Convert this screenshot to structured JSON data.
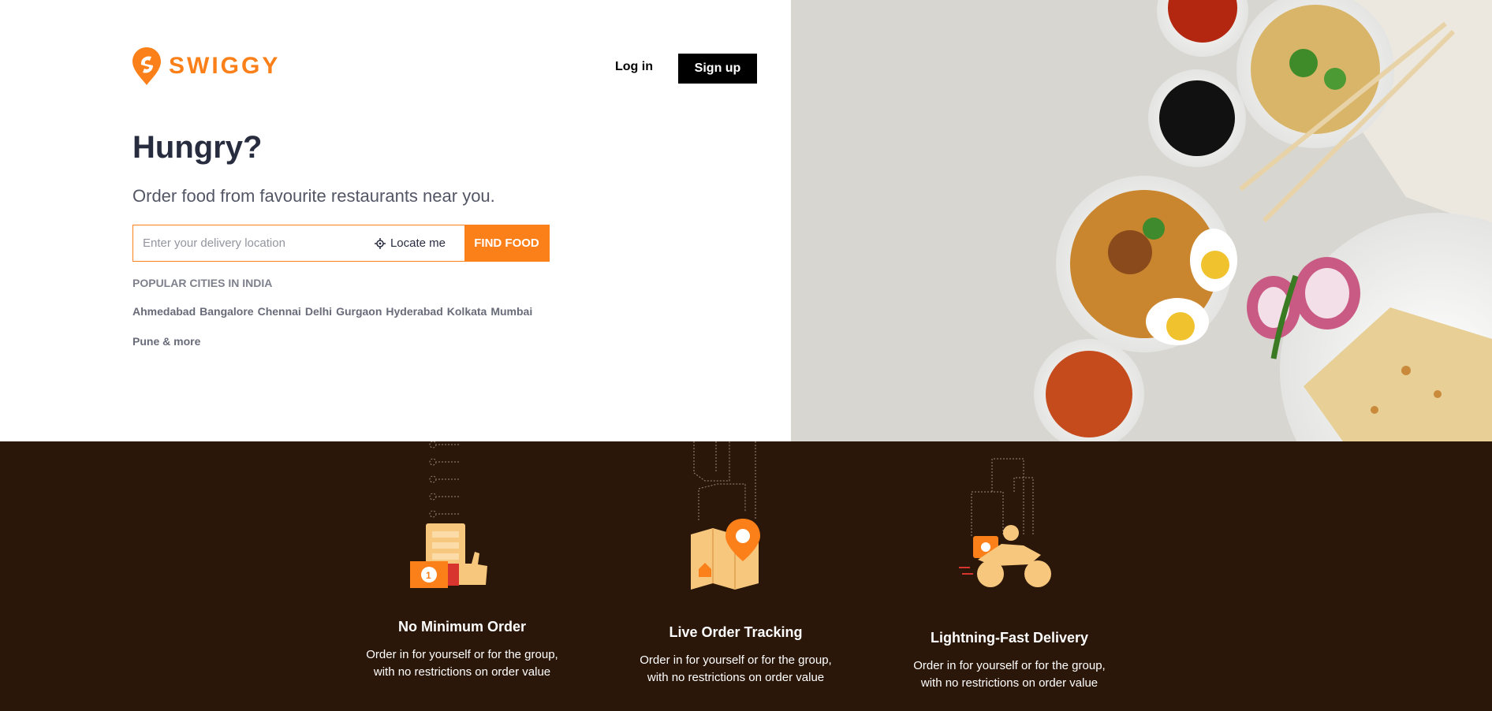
{
  "brand": {
    "name": "SWIGGY",
    "accent": "#fc8019"
  },
  "header": {
    "login_label": "Log in",
    "signup_label": "Sign up"
  },
  "hero": {
    "title": "Hungry?",
    "subtitle": "Order food from favourite restaurants near you.",
    "search": {
      "placeholder": "Enter your delivery location",
      "value": "",
      "locate_label": "Locate me",
      "find_label": "FIND FOOD"
    },
    "popular_title": "POPULAR CITIES IN INDIA",
    "cities": [
      "Ahmedabad",
      "Bangalore",
      "Chennai",
      "Delhi",
      "Gurgaon",
      "Hyderabad",
      "Kolkata",
      "Mumbai"
    ],
    "more_label": "Pune & more"
  },
  "features": [
    {
      "title": "No Minimum Order",
      "line1": "Order in for yourself or for the group,",
      "line2": "with no restrictions on order value"
    },
    {
      "title": "Live Order Tracking",
      "line1": "Order in for yourself or for the group,",
      "line2": "with no restrictions on order value"
    },
    {
      "title": "Lightning-Fast Delivery",
      "line1": "Order in for yourself or for the group,",
      "line2": "with no restrictions on order value"
    }
  ]
}
